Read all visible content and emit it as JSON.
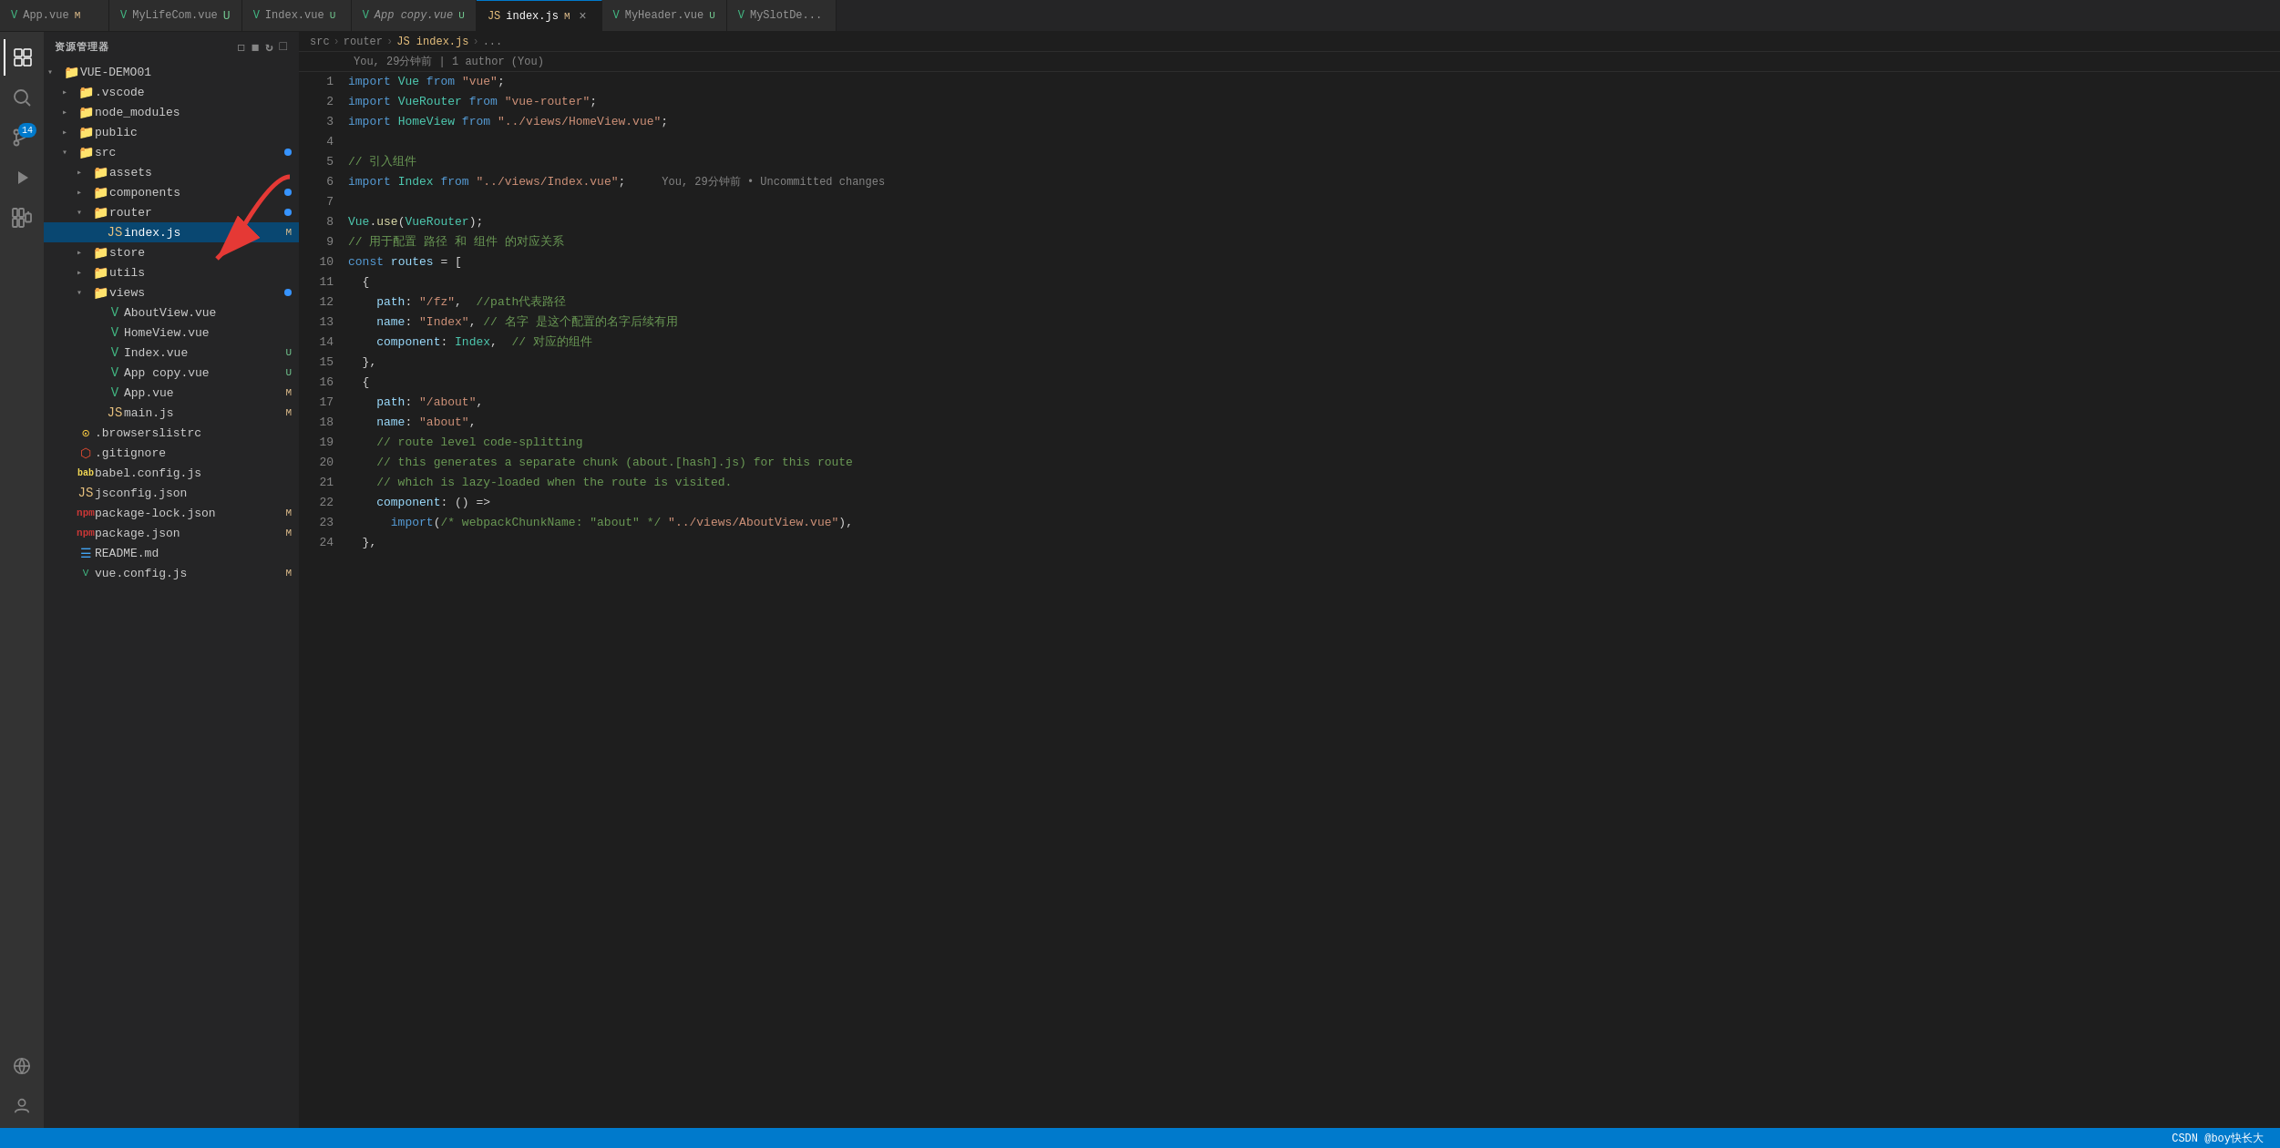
{
  "tabs": [
    {
      "id": "app-vue",
      "label": "App.vue",
      "icon": "V",
      "iconType": "vue",
      "badge": "M",
      "badgeType": "modified",
      "active": false
    },
    {
      "id": "mylifecom-vue",
      "label": "MyLifeCom.vue",
      "icon": "V",
      "iconType": "vue",
      "badge": "U",
      "badgeType": "untracked",
      "active": false
    },
    {
      "id": "index-vue",
      "label": "Index.vue",
      "icon": "V",
      "iconType": "vue",
      "badge": "U",
      "badgeType": "untracked",
      "active": false
    },
    {
      "id": "app-copy-vue",
      "label": "App copy.vue",
      "icon": "V",
      "iconType": "vue",
      "badge": "U",
      "badgeType": "untracked",
      "active": false,
      "italic": true
    },
    {
      "id": "index-js",
      "label": "index.js",
      "icon": "JS",
      "iconType": "js",
      "badge": "M",
      "badgeType": "modified",
      "active": true,
      "showClose": true
    },
    {
      "id": "myheader-vue",
      "label": "MyHeader.vue",
      "icon": "V",
      "iconType": "vue",
      "badge": "U",
      "badgeType": "untracked",
      "active": false
    },
    {
      "id": "myslotde",
      "label": "MySlotDe...",
      "icon": "V",
      "iconType": "vue",
      "badge": "",
      "badgeType": "",
      "active": false
    }
  ],
  "sidebar": {
    "title": "资源管理器",
    "project": "VUE-DEMO01",
    "items": [
      {
        "id": "vscode",
        "name": ".vscode",
        "type": "folder",
        "indent": 1,
        "collapsed": true,
        "iconColor": "#75beff"
      },
      {
        "id": "node_modules",
        "name": "node_modules",
        "type": "folder",
        "indent": 1,
        "collapsed": true,
        "iconColor": "#e06c75"
      },
      {
        "id": "public",
        "name": "public",
        "type": "folder",
        "indent": 1,
        "collapsed": true,
        "iconColor": "#dcb67a"
      },
      {
        "id": "src",
        "name": "src",
        "type": "folder",
        "indent": 1,
        "collapsed": false,
        "dot": true,
        "iconColor": "#e06c75"
      },
      {
        "id": "assets",
        "name": "assets",
        "type": "folder",
        "indent": 2,
        "collapsed": true,
        "iconColor": "#dcb67a"
      },
      {
        "id": "components",
        "name": "components",
        "type": "folder",
        "indent": 2,
        "collapsed": true,
        "dot": true,
        "iconColor": "#e06c75"
      },
      {
        "id": "router",
        "name": "router",
        "type": "folder",
        "indent": 2,
        "collapsed": false,
        "dot": true,
        "iconColor": "#e06c75"
      },
      {
        "id": "index-js-tree",
        "name": "index.js",
        "type": "js",
        "indent": 3,
        "badge": "M",
        "badgeType": "modified",
        "active": true
      },
      {
        "id": "store",
        "name": "store",
        "type": "folder",
        "indent": 2,
        "collapsed": true,
        "iconColor": "#dcb67a"
      },
      {
        "id": "utils",
        "name": "utils",
        "type": "folder",
        "indent": 2,
        "collapsed": true,
        "iconColor": "#e06c75"
      },
      {
        "id": "views",
        "name": "views",
        "type": "folder",
        "indent": 2,
        "collapsed": false,
        "dot": true,
        "iconColor": "#e06c75"
      },
      {
        "id": "aboutview",
        "name": "AboutView.vue",
        "type": "vue",
        "indent": 3
      },
      {
        "id": "homeview",
        "name": "HomeView.vue",
        "type": "vue",
        "indent": 3
      },
      {
        "id": "indexview",
        "name": "Index.vue",
        "type": "vue",
        "indent": 3,
        "badge": "U",
        "badgeType": "untracked"
      },
      {
        "id": "appcopy",
        "name": "App copy.vue",
        "type": "vue",
        "indent": 3,
        "badge": "U",
        "badgeType": "untracked"
      },
      {
        "id": "appvue",
        "name": "App.vue",
        "type": "vue",
        "indent": 3,
        "badge": "M",
        "badgeType": "modified"
      },
      {
        "id": "mainjs",
        "name": "main.js",
        "type": "js",
        "indent": 3,
        "badge": "M",
        "badgeType": "modified"
      },
      {
        "id": "browserslist",
        "name": ".browserslistrc",
        "type": "config",
        "indent": 1
      },
      {
        "id": "gitignore",
        "name": ".gitignore",
        "type": "git",
        "indent": 1
      },
      {
        "id": "babelconfig",
        "name": "babel.config.js",
        "type": "babel",
        "indent": 1
      },
      {
        "id": "jsconfig",
        "name": "jsconfig.json",
        "type": "js",
        "indent": 1
      },
      {
        "id": "packagelock",
        "name": "package-lock.json",
        "type": "npm",
        "indent": 1,
        "badge": "M",
        "badgeType": "modified"
      },
      {
        "id": "packagejson",
        "name": "package.json",
        "type": "npm",
        "indent": 1,
        "badge": "M",
        "badgeType": "modified"
      },
      {
        "id": "readme",
        "name": "README.md",
        "type": "md",
        "indent": 1
      },
      {
        "id": "vueconfig",
        "name": "vue.config.js",
        "type": "vue-sm",
        "indent": 1,
        "badge": "M",
        "badgeType": "modified"
      }
    ]
  },
  "breadcrumb": {
    "items": [
      "src",
      "router",
      "JS index.js",
      "..."
    ]
  },
  "git_blame": "You, 29分钟前 | 1 author (You)",
  "code": {
    "lines": [
      {
        "num": 1,
        "content": "import_vue_from_vue",
        "html": "<span class='kw'>import</span> <span class='cls'>Vue</span> <span class='kw'>from</span> <span class='str'>\"vue\"</span><span class='punc'>;</span>"
      },
      {
        "num": 2,
        "content": "import_vuerouter_from_vue_router",
        "html": "<span class='kw'>import</span> <span class='cls'>VueRouter</span> <span class='kw'>from</span> <span class='str'>\"vue-router\"</span><span class='punc'>;</span>"
      },
      {
        "num": 3,
        "content": "import_homeview",
        "html": "<span class='kw'>import</span> <span class='cls'>HomeView</span> <span class='kw'>from</span> <span class='str'>\"../views/HomeView.vue\"</span><span class='punc'>;</span>"
      },
      {
        "num": 4,
        "content": "",
        "html": ""
      },
      {
        "num": 5,
        "content": "comment_yinru",
        "html": "<span class='cmt'>// 引入组件</span>"
      },
      {
        "num": 6,
        "content": "import_index",
        "html": "<span class='kw'>import</span> <span class='cls'>Index</span> <span class='kw'>from</span> <span class='str'>\"../views/Index.vue\"</span><span class='punc'>;</span>",
        "blame": "You, 29分钟前 • Uncommitted changes"
      },
      {
        "num": 7,
        "content": "",
        "html": ""
      },
      {
        "num": 8,
        "content": "vue_use_vuerouter",
        "html": "<span class='cls'>Vue</span><span class='punc'>.</span><span class='fn'>use</span><span class='punc'>(</span><span class='cls'>VueRouter</span><span class='punc'>);</span>"
      },
      {
        "num": 9,
        "content": "comment_peizhi",
        "html": "<span class='cmt'>// 用于配置 路径 和 组件 的对应关系</span>"
      },
      {
        "num": 10,
        "content": "const_routes",
        "html": "<span class='kw'>const</span> <span class='var'>routes</span> <span class='op'>=</span> <span class='punc'>[</span>"
      },
      {
        "num": 11,
        "content": "open_brace",
        "html": "  <span class='punc'>{</span>"
      },
      {
        "num": 12,
        "content": "path_fz",
        "html": "    <span class='prop'>path</span><span class='punc'>:</span> <span class='str'>\"/fz\"</span><span class='punc'>,</span>  <span class='cmt'>//path代表路径</span>"
      },
      {
        "num": 13,
        "content": "name_index",
        "html": "    <span class='prop'>name</span><span class='punc'>:</span> <span class='str'>\"Index\"</span><span class='punc'>,</span> <span class='cmt'>// 名字 是这个配置的名字后续有用</span>"
      },
      {
        "num": 14,
        "content": "component_index",
        "html": "    <span class='prop'>component</span><span class='punc'>:</span> <span class='cls'>Index</span><span class='punc'>,</span>  <span class='cmt'>// 对应的组件</span>"
      },
      {
        "num": 15,
        "content": "close_brace_comma",
        "html": "  <span class='punc'>},</span>"
      },
      {
        "num": 16,
        "content": "open_brace2",
        "html": "  <span class='punc'>{</span>"
      },
      {
        "num": 17,
        "content": "path_about",
        "html": "    <span class='prop'>path</span><span class='punc'>:</span> <span class='str'>\"/about\"</span><span class='punc'>,</span>"
      },
      {
        "num": 18,
        "content": "name_about",
        "html": "    <span class='prop'>name</span><span class='punc'>:</span> <span class='str'>\"about\"</span><span class='punc'>,</span>"
      },
      {
        "num": 19,
        "content": "comment_codesplitting",
        "html": "    <span class='cmt'>// route level code-splitting</span>"
      },
      {
        "num": 20,
        "content": "comment_generates",
        "html": "    <span class='cmt'>// this generates a separate chunk (about.[hash].js) for this route</span>"
      },
      {
        "num": 21,
        "content": "comment_lazyloaded",
        "html": "    <span class='cmt'>// which is lazy-loaded when the route is visited.</span>"
      },
      {
        "num": 22,
        "content": "component_arrow",
        "html": "    <span class='prop'>component</span><span class='punc'>:</span> <span class='punc'>() =></span>"
      },
      {
        "num": 23,
        "content": "import_aboutview",
        "html": "      <span class='kw'>import</span><span class='punc'>(</span><span class='cmt'>/* webpackChunkName: \"about\" */</span> <span class='str'>\"../views/AboutView.vue\"</span><span class='punc'>),</span>"
      },
      {
        "num": 24,
        "content": "close_brace3",
        "html": "  <span class='punc'>},</span>"
      }
    ]
  },
  "status_bar": {
    "right_text": "CSDN @boy快长大"
  },
  "activity": {
    "items": [
      {
        "id": "explorer",
        "icon": "⧉",
        "active": true,
        "label": "Explorer"
      },
      {
        "id": "search",
        "icon": "🔍",
        "active": false,
        "label": "Search"
      },
      {
        "id": "source-control",
        "icon": "⎇",
        "active": false,
        "label": "Source Control",
        "badge": "14"
      },
      {
        "id": "run",
        "icon": "▷",
        "active": false,
        "label": "Run"
      },
      {
        "id": "extensions",
        "icon": "⊞",
        "active": false,
        "label": "Extensions"
      },
      {
        "id": "remote",
        "icon": "⚙",
        "active": false,
        "label": "Remote"
      },
      {
        "id": "accounts",
        "icon": "◉",
        "active": false,
        "label": "Accounts"
      }
    ]
  }
}
